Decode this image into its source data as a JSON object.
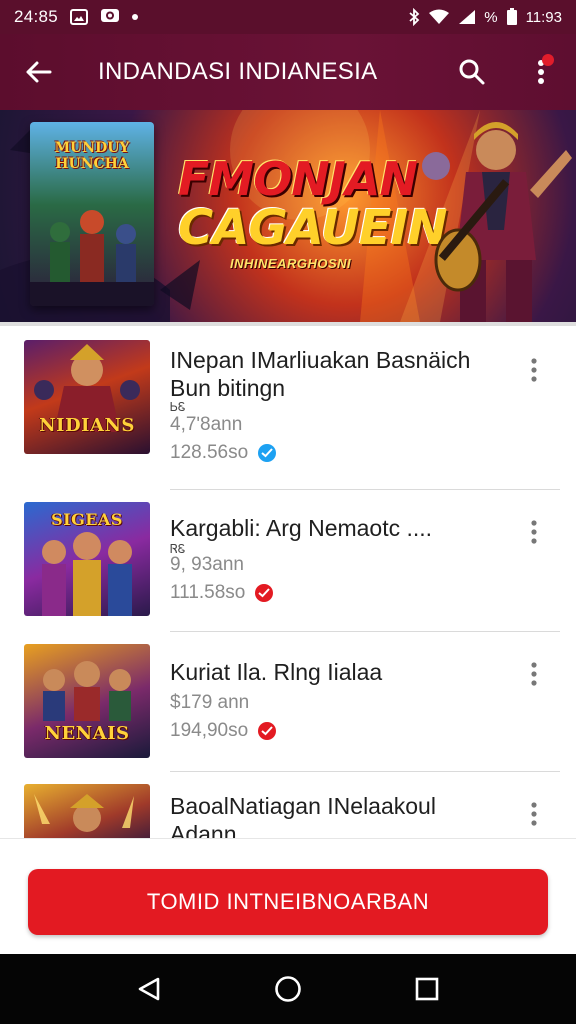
{
  "status_bar": {
    "time": "24:85",
    "left_icons": [
      "photo-icon",
      "camera-icon",
      "dot-icon"
    ],
    "right_icons": [
      "bluetooth-icon",
      "wifi-icon",
      "signal-icon",
      "battery-icon"
    ],
    "percent": "%",
    "right_time": "11:93"
  },
  "app_bar": {
    "title": "INDANDASI INDIANESIA",
    "accent": "#f0a500",
    "background": "#5c0d2d"
  },
  "banner": {
    "box_title": "MUNDUY HUNCHA",
    "title_line1": "FMONJAN",
    "title_line2": "CAGAUEIN",
    "subtitle": "INHINEARGHOSNI"
  },
  "items": [
    {
      "thumb_title": "NIDIANS",
      "title_line1": "INepan IMarliuakan Basnäich",
      "title_line2": "Bun bitingn",
      "extra": "ᏏᏋ",
      "subtitle": "4,7ʹ8ann",
      "count": "128.56so",
      "badge_icon": "verified-check-icon",
      "badge_color": "#1da1f2"
    },
    {
      "thumb_title": "SIGEAS",
      "title_line1": "Kargabli: Arg Nemaotc ....",
      "title_line2": "",
      "extra": "ᏒᏋ",
      "subtitle": "9, 93ann",
      "count": "111.58so",
      "badge_icon": "verified-check-icon",
      "badge_color": "#e31a22"
    },
    {
      "thumb_title": "NENAIS",
      "title_line1": "Kuriat Ila. Rlng Iialaa",
      "title_line2": "",
      "extra": "",
      "subtitle": "$179 ann",
      "count": "194,90so",
      "badge_icon": "verified-check-icon",
      "badge_color": "#e31a22"
    },
    {
      "thumb_title": "",
      "title_line1": "BaoalNatiagan INelaakoul",
      "title_line2": "Adann",
      "extra": "",
      "subtitle": "",
      "count": "",
      "badge_icon": "",
      "badge_color": ""
    }
  ],
  "cta": {
    "label": "TOMID INTNEIBNOARBAN",
    "color": "#e31a22"
  },
  "nav_bar": {
    "buttons": [
      "back-triangle-icon",
      "home-circle-icon",
      "recents-square-icon"
    ]
  }
}
